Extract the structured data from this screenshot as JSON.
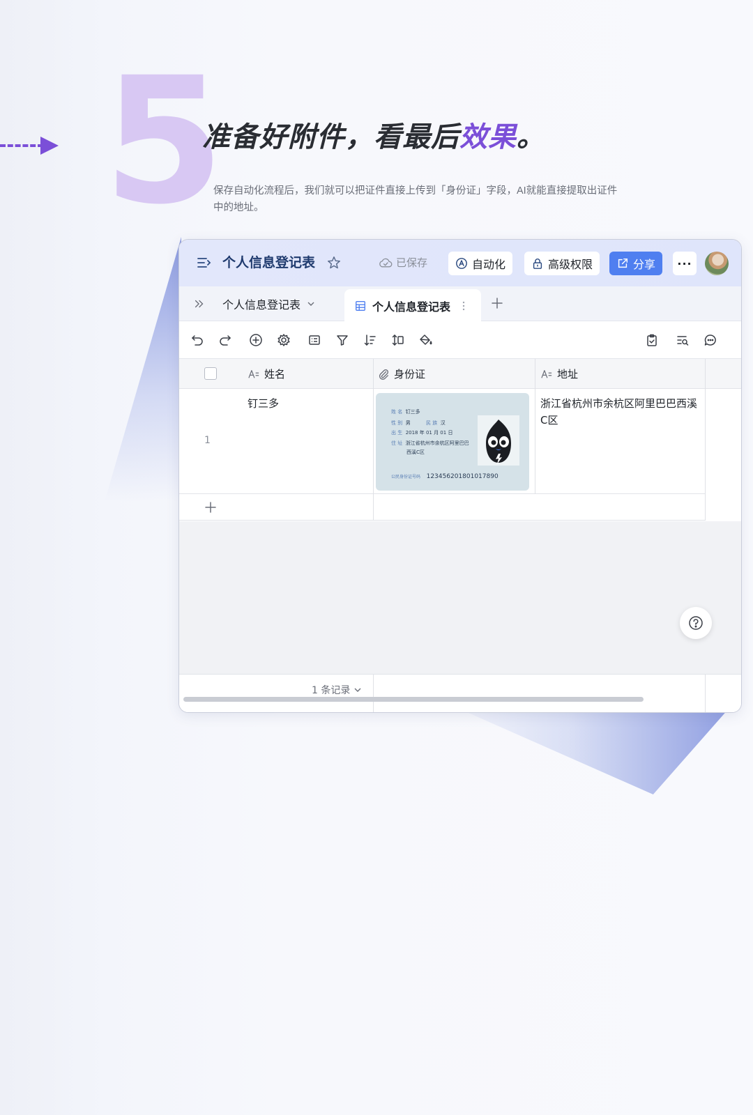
{
  "step": {
    "number": "5",
    "title_main": "准备好附件，看最后",
    "title_accent": "效果",
    "title_end": "。",
    "description": "保存自动化流程后，我们就可以把证件直接上传到「身份证」字段，AI就能直接提取出证件中的地址。"
  },
  "window": {
    "title": "个人信息登记表",
    "saved_label": "已保存",
    "automation_label": "自动化",
    "permission_label": "高级权限",
    "share_label": "分享",
    "more_label": "···"
  },
  "tabs": {
    "parent_label": "个人信息登记表",
    "active_label": "个人信息登记表"
  },
  "table": {
    "columns": [
      "姓名",
      "身份证",
      "地址"
    ],
    "rows": [
      {
        "index": "1",
        "name": "钉三多",
        "address": "浙江省杭州市余杭区阿里巴巴西溪C区"
      }
    ],
    "record_count": "1 条记录"
  },
  "id_card": {
    "name_label": "姓 名",
    "name": "钉三多",
    "gender_label": "性 别",
    "gender": "男",
    "ethnicity_label": "民 族",
    "ethnicity": "汉",
    "birth_label": "出 生",
    "birth": "2018  年 01  月  01  日",
    "address_label": "住 址",
    "address_line1": "浙江省杭州市余杭区阿里巴巴",
    "address_line2": "西溪C区",
    "id_label": "公民身份证号码",
    "id_number": "123456201801017890"
  },
  "colors": {
    "accent": "#7b4fd8",
    "big_number": "#d8c8f3",
    "share_button": "#4f7ff0",
    "title_blue": "#1f3a6e"
  }
}
